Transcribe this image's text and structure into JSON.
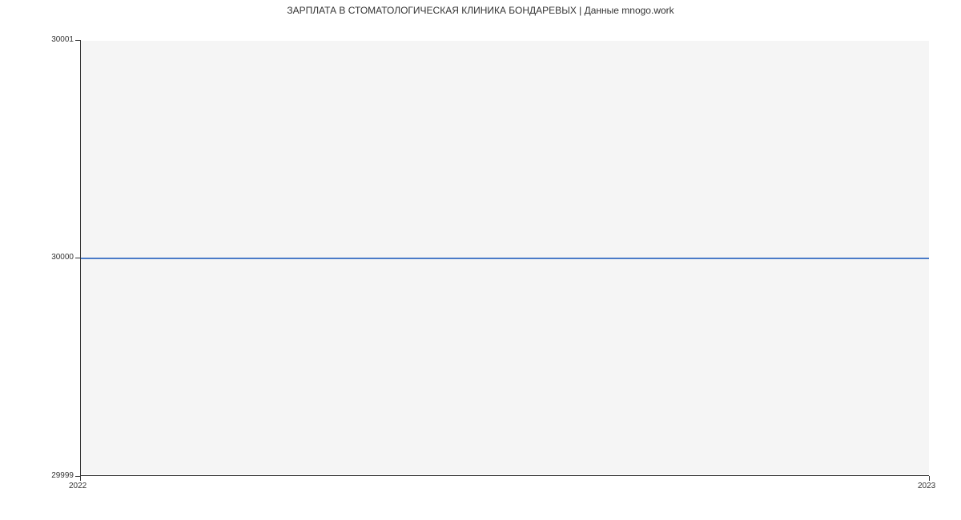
{
  "chart_data": {
    "type": "line",
    "title": "ЗАРПЛАТА В СТОМАТОЛОГИЧЕСКАЯ КЛИНИКА БОНДАРЕВЫХ | Данные mnogo.work",
    "xlabel": "",
    "ylabel": "",
    "x": [
      "2022",
      "2023"
    ],
    "series": [
      {
        "name": "salary",
        "values": [
          30000,
          30000
        ],
        "color": "#4a7bc8"
      }
    ],
    "ylim": [
      29999,
      30001
    ],
    "y_ticks": [
      29999,
      30000,
      30001
    ],
    "x_ticks": [
      "2022",
      "2023"
    ]
  }
}
